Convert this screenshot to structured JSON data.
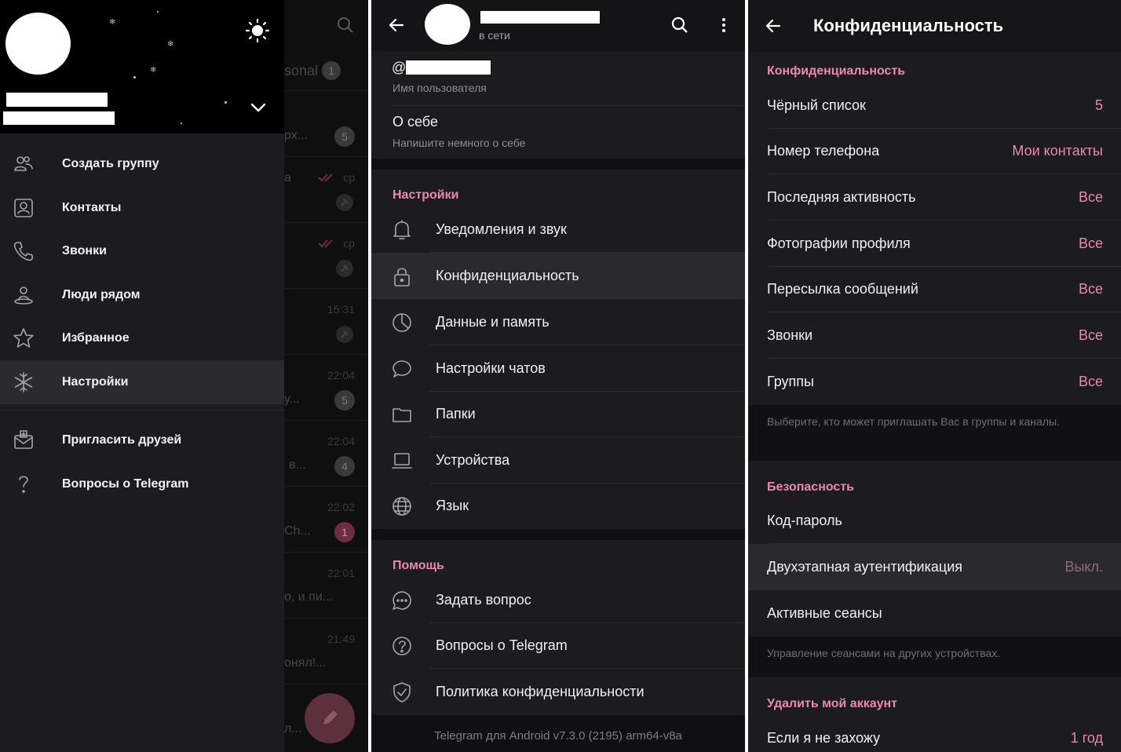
{
  "drawer": {
    "items": [
      {
        "icon": "group-add-icon",
        "label": "Создать группу"
      },
      {
        "icon": "contacts-icon",
        "label": "Контакты"
      },
      {
        "icon": "calls-icon",
        "label": "Звонки"
      },
      {
        "icon": "people-nearby-icon",
        "label": "Люди рядом"
      },
      {
        "icon": "star-icon",
        "label": "Избранное"
      },
      {
        "icon": "snowflake-icon",
        "label": "Настройки"
      },
      {
        "icon": "invite-icon",
        "label": "Пригласить друзей"
      },
      {
        "icon": "question-icon",
        "label": "Вопросы о Telegram"
      }
    ],
    "selected": "Настройки"
  },
  "chatlist": {
    "tab": "sonal",
    "tab_badge": "1",
    "rows": [
      {
        "snippet": "рх...",
        "time": "",
        "badge": "5"
      },
      {
        "snippet": "а",
        "time": "ср",
        "badge": ""
      },
      {
        "snippet": "",
        "time": "ср",
        "badge": ""
      },
      {
        "snippet": "",
        "time": "15:31",
        "badge": ""
      },
      {
        "snippet": "у...",
        "time": "22:04",
        "badge": "5"
      },
      {
        "snippet": "в...",
        "time": "22:04",
        "badge": "4"
      },
      {
        "snippet": "Ch...",
        "time": "22:02",
        "badge": "1"
      },
      {
        "snippet": "о, и пи...",
        "time": "22:01",
        "badge": ""
      },
      {
        "snippet": "онял!...",
        "time": "21:49",
        "badge": ""
      },
      {
        "snippet": "л...",
        "time": "",
        "badge": ""
      }
    ]
  },
  "settings": {
    "status": "в сети",
    "username_prefix": "@",
    "username_caption": "Имя пользователя",
    "about_title": "О себе",
    "about_caption": "Напишите немного о себе",
    "section_settings": "Настройки",
    "items": [
      {
        "icon": "bell-icon",
        "label": "Уведомления и звук"
      },
      {
        "icon": "lock-icon",
        "label": "Конфиденциальность"
      },
      {
        "icon": "data-usage-icon",
        "label": "Данные и память"
      },
      {
        "icon": "chat-bubble-icon",
        "label": "Настройки чатов"
      },
      {
        "icon": "folder-icon",
        "label": "Папки"
      },
      {
        "icon": "laptop-icon",
        "label": "Устройства"
      },
      {
        "icon": "globe-icon",
        "label": "Язык"
      }
    ],
    "section_help": "Помощь",
    "help_items": [
      {
        "icon": "ask-bubble-icon",
        "label": "Задать вопрос"
      },
      {
        "icon": "help-circle-icon",
        "label": "Вопросы о Telegram"
      },
      {
        "icon": "shield-check-icon",
        "label": "Политика конфиденциальности"
      }
    ],
    "version": "Telegram для Android v7.3.0 (2195) arm64-v8a"
  },
  "privacy": {
    "title": "Конфиденциальность",
    "section_privacy": "Конфиденциальность",
    "rows": [
      {
        "label": "Чёрный список",
        "value": "5"
      },
      {
        "label": "Номер телефона",
        "value": "Мои контакты"
      },
      {
        "label": "Последняя активность",
        "value": "Все"
      },
      {
        "label": "Фотографии профиля",
        "value": "Все"
      },
      {
        "label": "Пересылка сообщений",
        "value": "Все"
      },
      {
        "label": "Звонки",
        "value": "Все"
      },
      {
        "label": "Группы",
        "value": "Все"
      }
    ],
    "groups_note": "Выберите, кто может приглашать Вас в группы и каналы.",
    "section_security": "Безопасность",
    "security_rows": [
      {
        "label": "Код-пароль",
        "value": ""
      },
      {
        "label": "Двухэтапная аутентификация",
        "value": "Выкл."
      },
      {
        "label": "Активные сеансы",
        "value": ""
      }
    ],
    "sessions_note": "Управление сеансами на других устройствах.",
    "section_delete": "Удалить мой аккаунт",
    "delete_row": {
      "label": "Если я не захожу",
      "value": "1 год"
    }
  },
  "colors": {
    "accent": "#e98aaa",
    "fab": "#b0586f",
    "background": "#1c1c1e"
  }
}
